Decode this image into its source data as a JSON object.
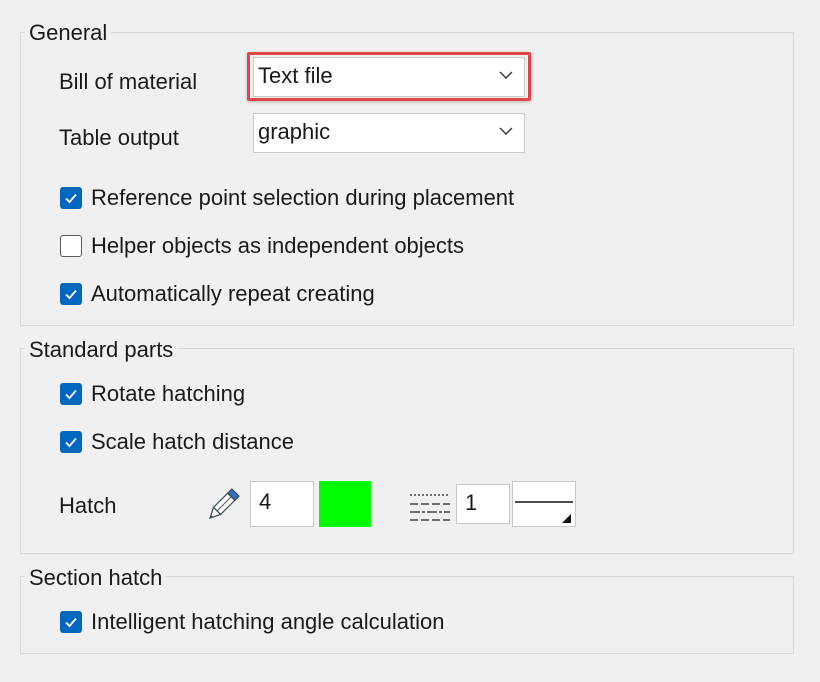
{
  "general": {
    "legend": "General",
    "bill_of_material": {
      "label": "Bill of material",
      "value": "Text file"
    },
    "table_output": {
      "label": "Table output",
      "value": "graphic"
    },
    "checkboxes": [
      {
        "label": "Reference point selection during placement",
        "checked": true
      },
      {
        "label": "Helper objects as independent objects",
        "checked": false
      },
      {
        "label": "Automatically repeat creating",
        "checked": true
      }
    ]
  },
  "standard_parts": {
    "legend": "Standard parts",
    "checkboxes": [
      {
        "label": "Rotate hatching",
        "checked": true
      },
      {
        "label": "Scale hatch distance",
        "checked": true
      }
    ],
    "hatch": {
      "label": "Hatch",
      "pen_value": "4",
      "color": "#00ff00",
      "line_value": "1",
      "icons": [
        "pencil-icon",
        "line-pattern-icon"
      ]
    }
  },
  "section_hatch": {
    "legend": "Section hatch",
    "checkboxes": [
      {
        "label": "Intelligent hatching angle calculation",
        "checked": true
      }
    ]
  },
  "colors": {
    "accent": "#0067c0",
    "highlight": "#e0464a",
    "background": "#f0f0f0"
  }
}
